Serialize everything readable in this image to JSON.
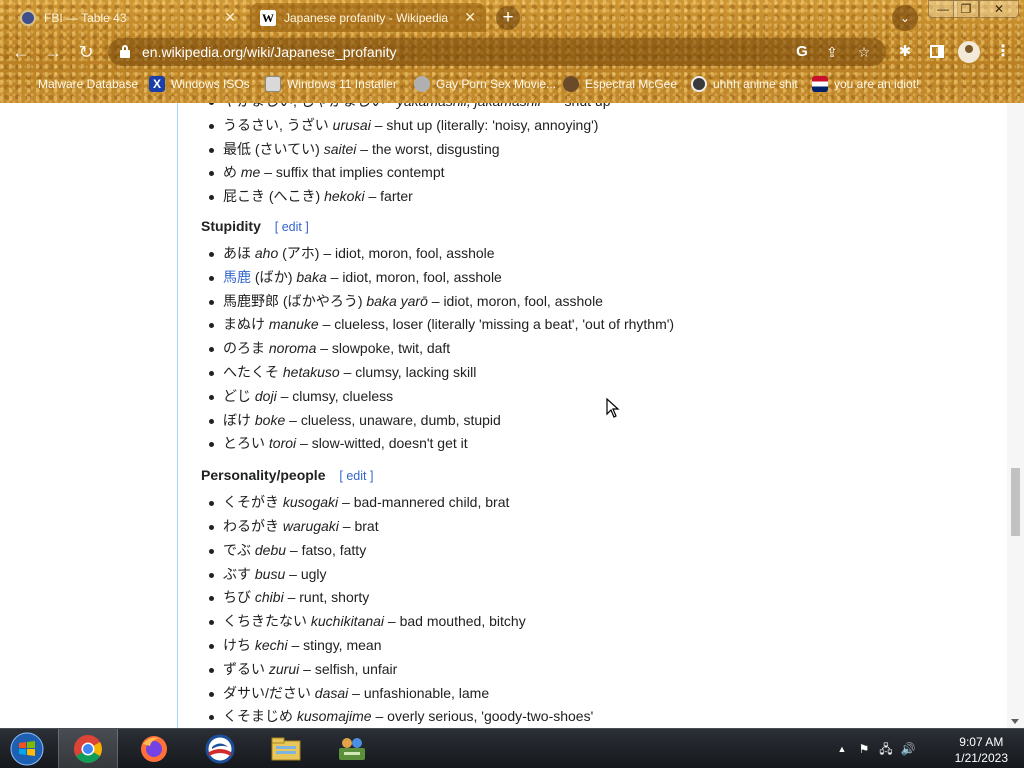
{
  "browser": {
    "tabs": [
      {
        "title": "FBI — Table 43",
        "close": "✕"
      },
      {
        "title": "Japanese profanity - Wikipedia",
        "close": "✕",
        "favicon": "W"
      }
    ],
    "new_tab": "+",
    "url": "en.wikipedia.org/wiki/Japanese_profanity",
    "window_controls": {
      "minimize": "—",
      "maximize": "❐",
      "close": "✕"
    },
    "icons": {
      "google": "G",
      "share": "⇪",
      "star": "☆",
      "extensions": "✱",
      "menu": "⋮",
      "back": "←",
      "forward": "→",
      "reload": "↻",
      "tab_search": "⌄"
    },
    "bookmarks": [
      {
        "label": "Malware Database",
        "icon": "blank",
        "color": "transparent"
      },
      {
        "label": "Windows ISOs",
        "icon": "x-logo",
        "color": "#1b3fa8"
      },
      {
        "label": "Windows 11 Installer",
        "icon": "installer-icon",
        "color": "#d9d9d9"
      },
      {
        "label": "Gay Porn Sex Movie...",
        "icon": "globe-icon",
        "color": "#b0b0b0"
      },
      {
        "label": "Espectral McGee",
        "icon": "avatar-icon",
        "color": "#6b4a2a"
      },
      {
        "label": "uhhh anime shit",
        "icon": "avatar-icon",
        "color": "#3a3a3a"
      },
      {
        "label": "you are an idiot!",
        "icon": "flag-icon",
        "color": "#c8102e"
      }
    ]
  },
  "article": {
    "intro_items": [
      {
        "jp": "やかましい, じゃかましい~",
        "romaji": "yakamashii, jakamashii~",
        "meaning": " – shut up"
      },
      {
        "jp": "うるさい, うざい",
        "romaji": "urusai",
        "meaning": " – shut up (literally: 'noisy, annoying')"
      },
      {
        "jp": "最低 (さいてい)",
        "romaji": "saitei",
        "meaning": " – the worst, disgusting"
      },
      {
        "jp": "め",
        "romaji": "me",
        "meaning": " – suffix that implies contempt"
      },
      {
        "jp": "屁こき (へこき)",
        "romaji": "hekoki",
        "meaning": " – farter"
      }
    ],
    "sections": [
      {
        "heading": "Stupidity",
        "edit_open": "[ ",
        "edit_label": "edit",
        "edit_close": " ]",
        "items": [
          {
            "jp": "あほ",
            "romaji": "aho",
            "extra": " (アホ)",
            "meaning": " – idiot, moron, fool, asshole"
          },
          {
            "jp_link": "馬鹿",
            "jp": " (ばか)",
            "romaji": "baka",
            "meaning": " – idiot, moron, fool, asshole"
          },
          {
            "jp": "馬鹿野郎 (ばかやろう)",
            "romaji": "baka yarō",
            "meaning": " – idiot, moron, fool, asshole"
          },
          {
            "jp": "まぬけ",
            "romaji": "manuke",
            "meaning": " – clueless, loser (literally 'missing a beat', 'out of rhythm')"
          },
          {
            "jp": "のろま",
            "romaji": "noroma",
            "meaning": " – slowpoke, twit, daft"
          },
          {
            "jp": "へたくそ",
            "romaji": "hetakuso",
            "meaning": " – clumsy, lacking skill"
          },
          {
            "jp": "どじ",
            "romaji": "doji",
            "meaning": " – clumsy, clueless"
          },
          {
            "jp": "ぼけ",
            "romaji": "boke",
            "meaning": " – clueless, unaware, dumb, stupid"
          },
          {
            "jp": "とろい",
            "romaji": "toroi",
            "meaning": " – slow-witted, doesn't get it"
          }
        ]
      },
      {
        "heading": "Personality/people",
        "edit_open": "[ ",
        "edit_label": "edit",
        "edit_close": " ]",
        "items": [
          {
            "jp": "くそがき",
            "romaji": "kusogaki",
            "meaning": " – bad-mannered child, brat"
          },
          {
            "jp": "わるがき",
            "romaji": "warugaki",
            "meaning": " – brat"
          },
          {
            "jp": "でぶ",
            "romaji": "debu",
            "meaning": " – fatso, fatty"
          },
          {
            "jp": "ぶす",
            "romaji": "busu",
            "meaning": " – ugly"
          },
          {
            "jp": "ちび",
            "romaji": "chibi",
            "meaning": " – runt, shorty"
          },
          {
            "jp": "くちきたない",
            "romaji": "kuchikitanai",
            "meaning": " – bad mouthed, bitchy"
          },
          {
            "jp": "けち",
            "romaji": "kechi",
            "meaning": " – stingy, mean"
          },
          {
            "jp": "ずるい",
            "romaji": "zurui",
            "meaning": " – selfish, unfair"
          },
          {
            "jp": "ダサい/ださい",
            "romaji": "dasai",
            "meaning": " – unfashionable, lame"
          },
          {
            "jp": "くそまじめ",
            "romaji": "kusomajime",
            "meaning": " – overly serious, 'goody-two-shoes'"
          }
        ]
      }
    ]
  },
  "taskbar": {
    "apps": [
      "start-orb",
      "chrome-icon",
      "firefox-icon",
      "obama-logo-icon",
      "file-explorer-icon",
      "network-users-icon"
    ],
    "tray_icons": {
      "chevron": "▲",
      "flag": "⚑",
      "network": "🖧",
      "volume": "🔊"
    },
    "time": "9:07 AM",
    "date": "1/21/2023"
  }
}
